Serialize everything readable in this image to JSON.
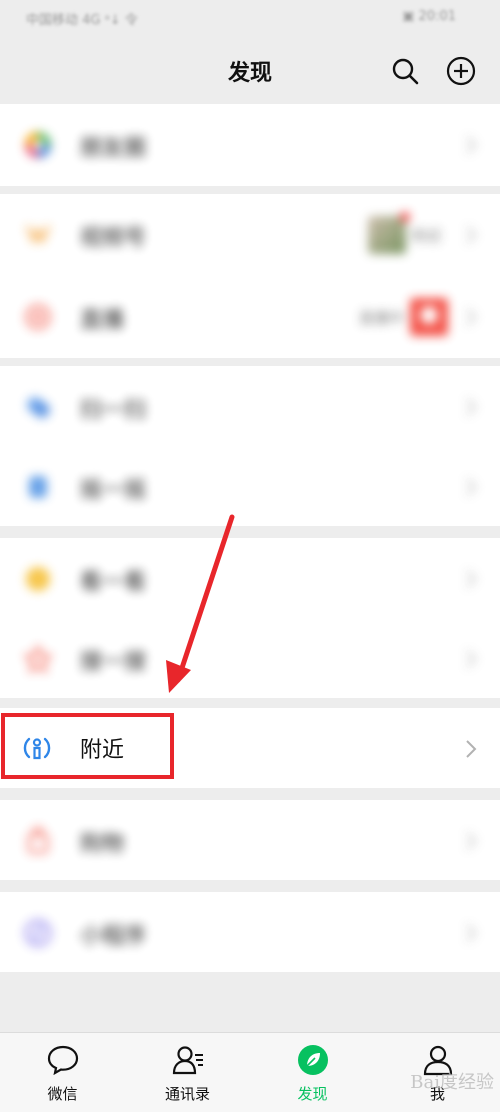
{
  "status_bar": {
    "left_text": "中国移动 4G ᵃ↓ 令",
    "right_text": "▣ 20:01"
  },
  "header": {
    "title": "发现",
    "search_icon": "search-icon",
    "add_icon": "plus-circle-icon"
  },
  "sections": [
    {
      "items": [
        {
          "label": "朋友圈",
          "icon": "moments-icon",
          "color": "#f7a300"
        }
      ]
    },
    {
      "items": [
        {
          "label": "视频号",
          "icon": "channels-icon",
          "color": "#f4a53f",
          "extra_text": "附近"
        },
        {
          "label": "直播",
          "icon": "live-icon",
          "color": "#f25a4a",
          "extra_text": "直播中"
        }
      ]
    },
    {
      "items": [
        {
          "label": "扫一扫",
          "icon": "scan-icon",
          "color": "#3a7ddc"
        },
        {
          "label": "摇一摇",
          "icon": "shake-icon",
          "color": "#3a7ddc"
        }
      ]
    },
    {
      "items": [
        {
          "label": "看一看",
          "icon": "top-stories-icon",
          "color": "#f6c23e"
        },
        {
          "label": "搜一搜",
          "icon": "search-star-icon",
          "color": "#f25a4a"
        }
      ]
    },
    {
      "items": [
        {
          "label": "附近",
          "icon": "nearby-icon",
          "color": "#2f86e8"
        }
      ]
    },
    {
      "items": [
        {
          "label": "购物",
          "icon": "shopping-icon",
          "color": "#f25a4a"
        }
      ]
    },
    {
      "items": [
        {
          "label": "小程序",
          "icon": "mini-program-icon",
          "color": "#6c5ce7"
        }
      ]
    }
  ],
  "tabs": [
    {
      "label": "微信",
      "icon": "chat-bubble-icon",
      "active": false
    },
    {
      "label": "通讯录",
      "icon": "contacts-icon",
      "active": false
    },
    {
      "label": "发现",
      "icon": "compass-icon",
      "active": true
    },
    {
      "label": "我",
      "icon": "person-icon",
      "active": false
    }
  ],
  "colors": {
    "accent": "#07c160",
    "highlight": "#e8262b",
    "background": "#ededed"
  },
  "watermark": "Bai度经验"
}
